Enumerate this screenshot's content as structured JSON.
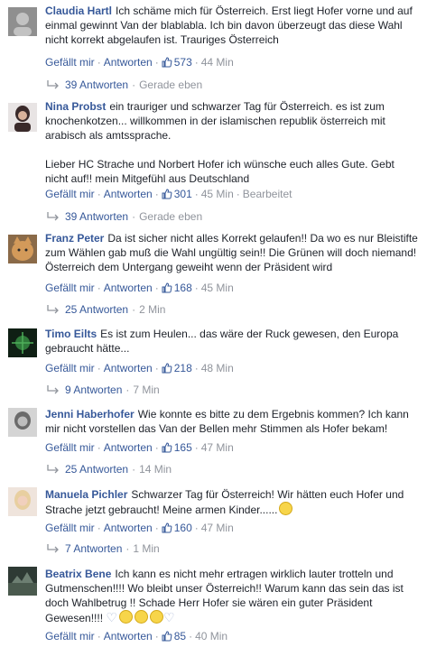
{
  "labels": {
    "like": "Gefällt mir",
    "reply": "Antworten",
    "edited": "Bearbeitet",
    "just_now": "Gerade eben"
  },
  "comments": [
    {
      "author": "Claudia Hartl",
      "text": "Ich schäme mich für Österreich. Erst liegt Hofer vorne und auf einmal gewinnt Van der blablabla. Ich bin davon überzeugt das diese Wahl nicht korrekt abgelaufen ist. Trauriges Österreich",
      "likes": "573",
      "time": "44 Min",
      "replies": "39 Antworten",
      "replies_time": "Gerade eben",
      "avatar_color": "#9a9a9a"
    },
    {
      "author": "Nina Probst",
      "text": "ein trauriger und schwarzer Tag für Österreich. es ist zum knochenkotzen... willkommen in der islamischen republik österreich mit arabisch als amtssprache.",
      "text2": "Lieber HC Strache und Norbert Hofer ich wünsche euch alles Gute. Gebt nicht auf!! mein Mitgefühl aus Deutschland",
      "likes": "301",
      "time": "45 Min",
      "replies": "39 Antworten",
      "replies_time": "Gerade eben",
      "avatar_color": "#4a3a3a"
    },
    {
      "author": "Franz Peter",
      "text": "Da ist sicher nicht alles Korrekt gelaufen!! Da wo es nur Bleistifte zum Wählen gab muß die Wahl ungültig sein!! Die Grünen will doch niemand! Österreich dem Untergang geweiht wenn der Präsident wird",
      "likes": "168",
      "time": "45 Min",
      "replies": "25 Antworten",
      "replies_time": "2 Min",
      "avatar_color": "#c98c4a"
    },
    {
      "author": "Timo Eilts",
      "text": "Es ist zum Heulen... das wäre der Ruck gewesen, den Europa gebraucht hätte...",
      "likes": "218",
      "time": "48 Min",
      "replies": "9 Antworten",
      "replies_time": "7 Min",
      "avatar_color": "#1f3a24"
    },
    {
      "author": "Jenni Haberhofer",
      "text": "Wie konnte es bitte zu dem Ergebnis kommen? Ich kann mir nicht vorstellen das Van der Bellen mehr Stimmen als Hofer bekam!",
      "likes": "165",
      "time": "47 Min",
      "replies": "25 Antworten",
      "replies_time": "14 Min",
      "avatar_color": "#b0b0b0"
    },
    {
      "author": "Manuela Pichler",
      "text": "Schwarzer Tag für Österreich! Wir hätten euch Hofer und Strache jetzt gebraucht! Meine armen Kinder......",
      "likes": "160",
      "time": "47 Min",
      "replies": "7 Antworten",
      "replies_time": "1 Min",
      "avatar_color": "#d8b8a0"
    },
    {
      "author": "Beatrix Bene",
      "text": "Ich kann es nicht mehr ertragen wirklich lauter trotteln und Gutmenschen!!!! Wo bleibt unser Österreich!! Warum kann das sein das ist doch Wahlbetrug !! Schade Herr Hofer sie wären ein guter Präsident Gewesen!!!!",
      "likes": "85",
      "time": "40 Min",
      "avatar_color": "#3a4a3a"
    }
  ]
}
